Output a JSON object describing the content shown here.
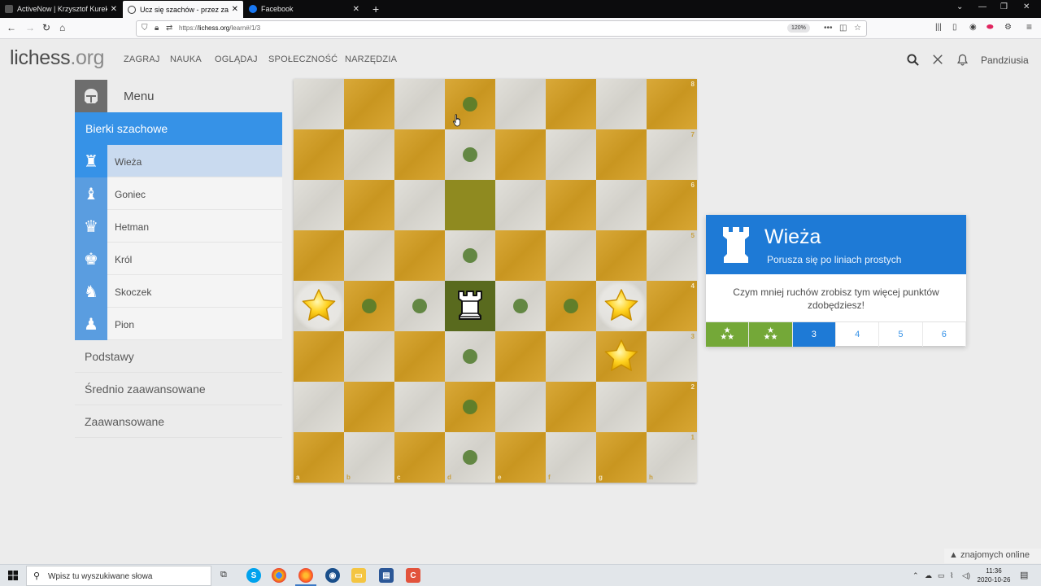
{
  "browser": {
    "tabs": [
      {
        "title": "ActiveNow | Krzysztof Kurek",
        "icon": "activenow-icon",
        "active": false
      },
      {
        "title": "Ucz się szachów - przez zabawę",
        "icon": "lichess-icon",
        "active": true
      },
      {
        "title": "Facebook",
        "icon": "facebook-icon",
        "active": false
      }
    ],
    "url_prefix": "https://",
    "url_host": "lichess.org",
    "url_path": "/learn#/1/3",
    "zoom": "120%"
  },
  "site": {
    "logo_main": "lichess",
    "logo_tld": ".org",
    "nav": [
      "ZAGRAJ",
      "NAUKA",
      "OGLĄDAJ",
      "SPOŁECZNOŚĆ",
      "NARZĘDZIA"
    ],
    "username": "Pandziusia"
  },
  "sidebar": {
    "menu_label": "Menu",
    "active_category": "Bierki szachowe",
    "stages": [
      {
        "label": "Wieża",
        "icon": "rook-icon",
        "current": true
      },
      {
        "label": "Goniec",
        "icon": "bishop-icon",
        "current": false
      },
      {
        "label": "Hetman",
        "icon": "queen-icon",
        "current": false
      },
      {
        "label": "Król",
        "icon": "king-icon",
        "current": false
      },
      {
        "label": "Skoczek",
        "icon": "knight-icon",
        "current": false
      },
      {
        "label": "Pion",
        "icon": "pawn-icon",
        "current": false
      }
    ],
    "categories": [
      "Podstawy",
      "Średnio zaawansowane",
      "Zaawansowane"
    ]
  },
  "board": {
    "files": [
      "a",
      "b",
      "c",
      "d",
      "e",
      "f",
      "g",
      "h"
    ],
    "ranks": [
      "8",
      "7",
      "6",
      "5",
      "4",
      "3",
      "2",
      "1"
    ],
    "piece": {
      "type": "rook",
      "color": "white",
      "square": "d4"
    },
    "last_move_square": "d6",
    "stars": [
      "a4",
      "g4",
      "g3"
    ],
    "move_dots": [
      "d8",
      "d7",
      "d5",
      "d3",
      "d2",
      "d1",
      "b4",
      "c4",
      "e4",
      "f4"
    ],
    "colors": {
      "light": "#dbd9d2",
      "dark": "#d59f22",
      "dot": "#4f7a2c"
    }
  },
  "lesson": {
    "title": "Wieża",
    "subtitle": "Porusza się po liniach prostych",
    "hint": "Czym mniej ruchów zrobisz tym więcej punktów zdobędziesz!",
    "steps": [
      {
        "label": "",
        "state": "done",
        "stars": 3
      },
      {
        "label": "",
        "state": "done",
        "stars": 3
      },
      {
        "label": "3",
        "state": "current"
      },
      {
        "label": "4",
        "state": "todo"
      },
      {
        "label": "5",
        "state": "todo"
      },
      {
        "label": "6",
        "state": "todo"
      }
    ]
  },
  "friends": {
    "label": "znajomych online"
  },
  "taskbar": {
    "search_placeholder": "Wpisz tu wyszukiwane słowa",
    "time": "11:36",
    "date": "2020-10-26"
  }
}
